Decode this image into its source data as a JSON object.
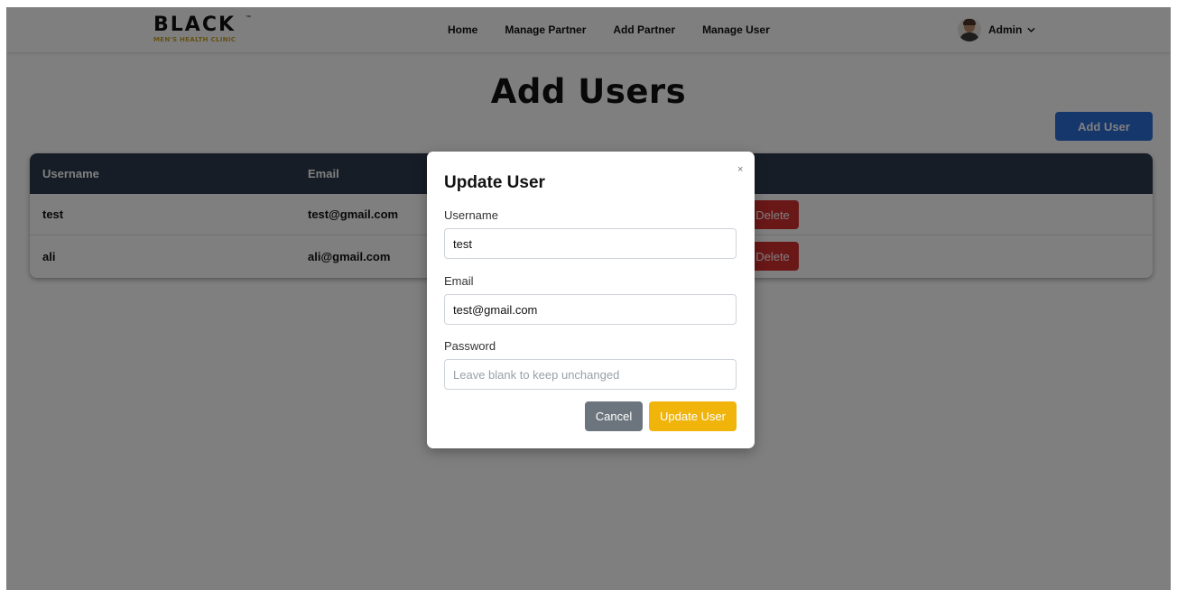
{
  "brand": {
    "name": "BLACK",
    "tagline": "MEN'S HEALTH CLINIC",
    "tagline_color": "#c9a227"
  },
  "nav": {
    "links": [
      "Home",
      "Manage Partner",
      "Add Partner",
      "Manage User"
    ],
    "user_label": "Admin"
  },
  "page": {
    "title": "Add Users",
    "add_user_label": "Add User"
  },
  "table": {
    "headers": [
      "Username",
      "Email"
    ],
    "rows": [
      {
        "username": "test",
        "email": "test@gmail.com",
        "delete_label": "Delete"
      },
      {
        "username": "ali",
        "email": "ali@gmail.com",
        "delete_label": "Delete"
      }
    ]
  },
  "modal": {
    "title": "Update User",
    "close_glyph": "×",
    "username_label": "Username",
    "username_value": "test",
    "email_label": "Email",
    "email_value": "test@gmail.com",
    "password_label": "Password",
    "password_placeholder": "Leave blank to keep unchanged",
    "cancel_label": "Cancel",
    "submit_label": "Update User"
  },
  "colors": {
    "primary": "#2d6fd9",
    "danger": "#d42e2e",
    "warning": "#f0b40b",
    "secondary": "#6c757d",
    "table_header": "#2e3b4e"
  }
}
